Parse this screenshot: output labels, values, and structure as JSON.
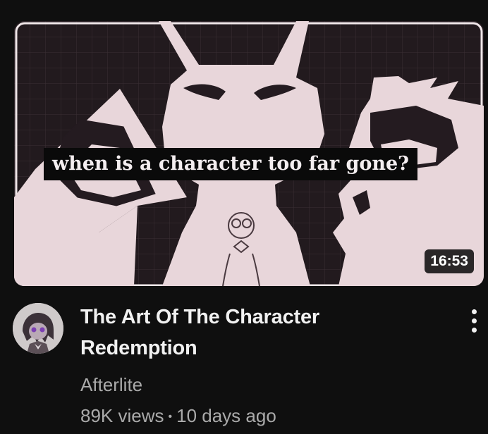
{
  "video": {
    "thumbnail_caption": "when is a character too far gone?",
    "duration": "16:53",
    "title_line1": "The Art Of The Character",
    "title_line2": "Redemption",
    "channel": "Afterlite",
    "views": "89K views",
    "separator": "•",
    "age": "10 days ago"
  },
  "icons": {
    "more": "more-vert-icon",
    "avatar": "channel-avatar"
  },
  "colors": {
    "background": "#0f0f0f",
    "title": "#f1f1f1",
    "secondary_text": "#aaaaaa",
    "thumbnail_bg": "#241b20",
    "figure": "#e8d6da"
  }
}
